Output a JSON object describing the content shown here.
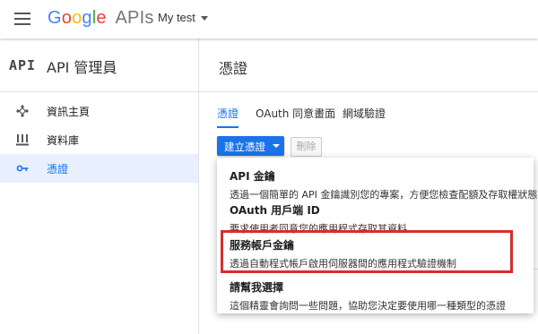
{
  "header": {
    "logo_google": "Google",
    "logo_apis": "APIs",
    "project": "My test"
  },
  "sidebar": {
    "api_mark": "API",
    "title": "API 管理員",
    "items": [
      {
        "label": "資訊主頁",
        "icon": "dashboard-diamond-icon"
      },
      {
        "label": "資料庫",
        "icon": "library-icon"
      },
      {
        "label": "憑證",
        "icon": "key-icon",
        "active": true
      }
    ]
  },
  "main": {
    "title": "憑證",
    "tabs": [
      {
        "label": "憑證",
        "active": true
      },
      {
        "label": "OAuth 同意畫面"
      },
      {
        "label": "網域驗證"
      }
    ],
    "create_button": "建立憑證",
    "delete_button": "刪除"
  },
  "dropdown": {
    "items": [
      {
        "title": "API 金鑰",
        "desc": "透過一個簡單的 API 金鑰識別您的專案，方便您檢查配額及存取權狀態"
      },
      {
        "title": "OAuth 用戶端 ID",
        "desc": "要求使用者同意您的應用程式存取其資料"
      },
      {
        "title": "服務帳戶金鑰",
        "desc": "透過自動程式帳戶啟用伺服器間的應用程式驗證機制"
      },
      {
        "title": "請幫我選擇",
        "desc": "這個精靈會詢問一些問題，協助您決定要使用哪一種類型的憑證"
      }
    ]
  },
  "colors": {
    "accent": "#1a73e8",
    "highlight": "#d32f2f",
    "active_bg": "#e8f0fe"
  }
}
